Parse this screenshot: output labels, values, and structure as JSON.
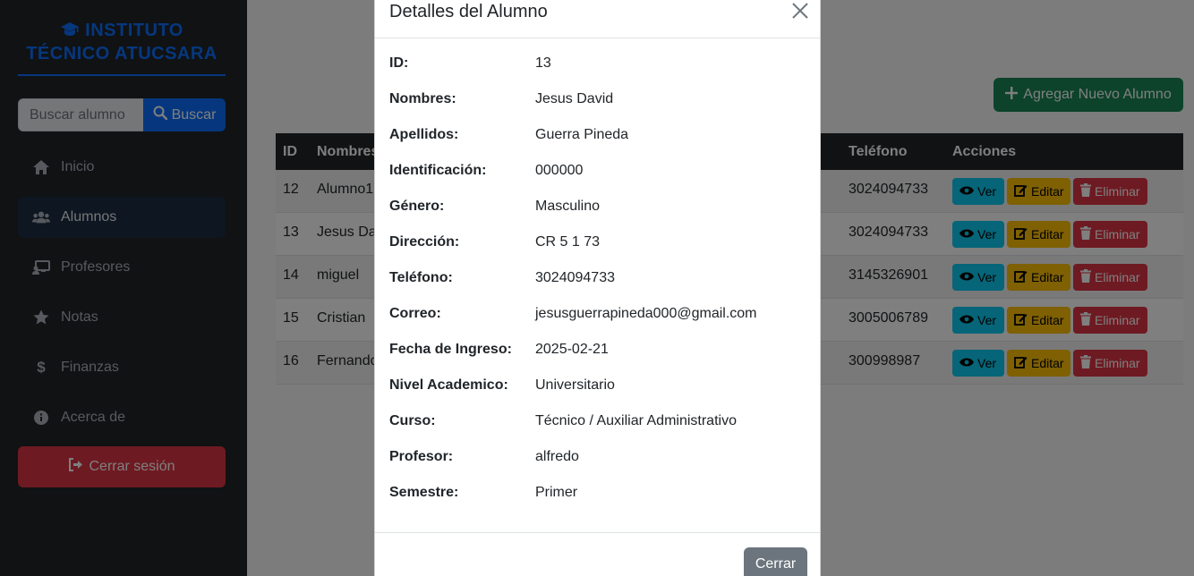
{
  "brand": {
    "line1": "INSTITUTO",
    "line2": "TÉCNICO ATUCSARA"
  },
  "search": {
    "placeholder": "Buscar alumno",
    "button_label": "Buscar"
  },
  "nav": [
    {
      "label": "Inicio",
      "icon": "home-icon"
    },
    {
      "label": "Alumnos",
      "icon": "users-icon",
      "active": true
    },
    {
      "label": "Profesores",
      "icon": "chalkboard-icon"
    },
    {
      "label": "Notas",
      "icon": "star-icon"
    },
    {
      "label": "Finanzas",
      "icon": "dollar-icon"
    },
    {
      "label": "Acerca de",
      "icon": "info-icon"
    }
  ],
  "logout_label": "Cerrar sesión",
  "add_button_label": "Agregar Nuevo Alumno",
  "table": {
    "headers": {
      "id": "ID",
      "name": "Nombres",
      "phone": "Teléfono",
      "actions": "Acciones"
    },
    "rows": [
      {
        "id": "12",
        "name": "Alumno1",
        "phone": "3024094733"
      },
      {
        "id": "13",
        "name": "Jesus Dav",
        "phone": "3024094733"
      },
      {
        "id": "14",
        "name": "miguel",
        "phone": "3145326901"
      },
      {
        "id": "15",
        "name": "Cristian",
        "phone": "3005006789",
        "overflow_glyph": "•"
      },
      {
        "id": "16",
        "name": "Fernando",
        "phone": "300998987"
      }
    ],
    "actions": {
      "view": "Ver",
      "edit": "Editar",
      "delete": "Eliminar"
    }
  },
  "modal": {
    "title": "Detalles del Alumno",
    "close_button_label": "Cerrar",
    "fields": [
      {
        "label": "ID:",
        "value": "13"
      },
      {
        "label": "Nombres:",
        "value": "Jesus David"
      },
      {
        "label": "Apellidos:",
        "value": "Guerra Pineda"
      },
      {
        "label": "Identificación:",
        "value": "000000"
      },
      {
        "label": "Género:",
        "value": "Masculino"
      },
      {
        "label": "Dirección:",
        "value": "CR 5 1 73"
      },
      {
        "label": "Teléfono:",
        "value": "3024094733"
      },
      {
        "label": "Correo:",
        "value": "jesusguerrapineda000@gmail.com"
      },
      {
        "label": "Fecha de Ingreso:",
        "value": "2025-02-21"
      },
      {
        "label": "Nivel Academico:",
        "value": "Universitario"
      },
      {
        "label": "Curso:",
        "value": "Técnico / Auxiliar Administrativo"
      },
      {
        "label": "Profesor:",
        "value": "alfredo"
      },
      {
        "label": "Semestre:",
        "value": "Primer"
      }
    ]
  },
  "colors": {
    "sidebar_bg": "#212529",
    "brand": "#0d6efd",
    "success": "#198754",
    "danger": "#dc3545",
    "info": "#0dcaf0",
    "warning": "#ffc107",
    "secondary": "#6c757d"
  }
}
